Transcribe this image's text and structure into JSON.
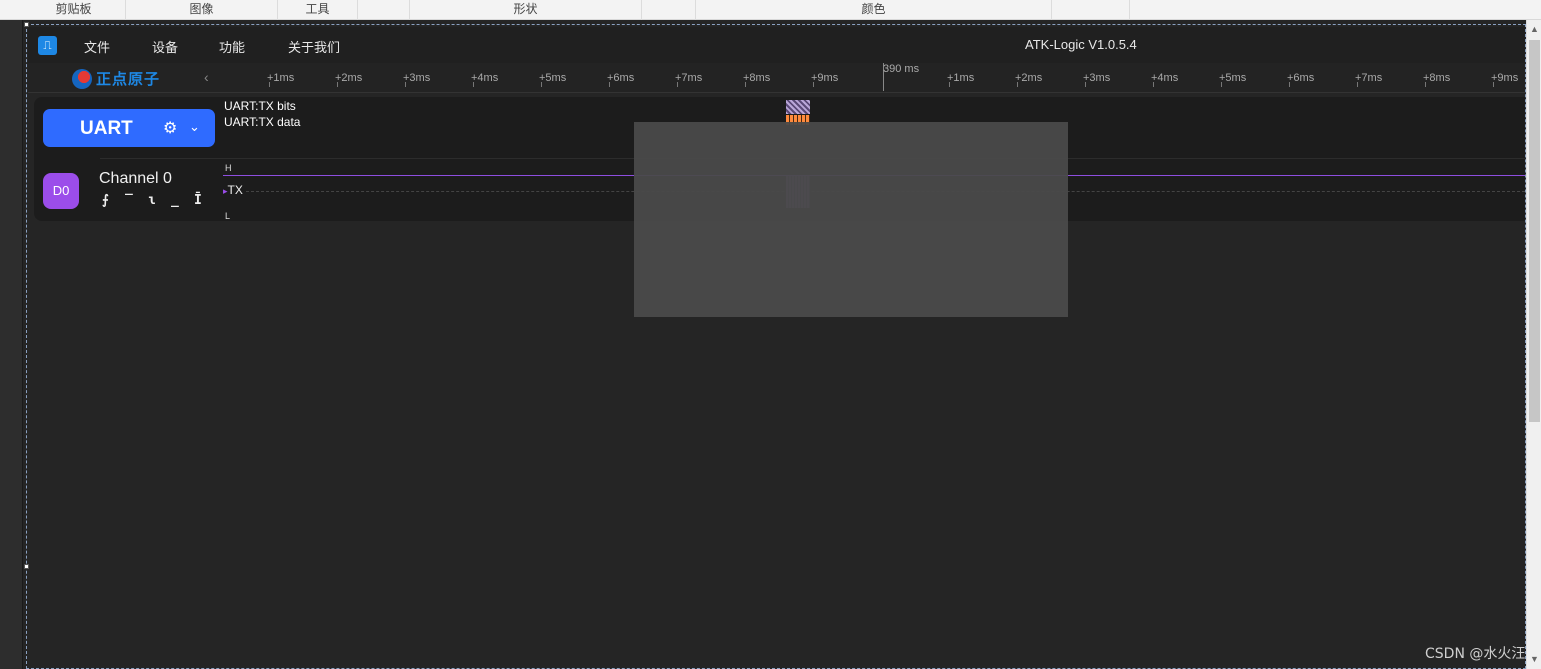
{
  "ribbon": {
    "groups": [
      "剪贴板",
      "图像",
      "工具",
      "形状",
      "颜色"
    ]
  },
  "app": {
    "logo_icon": "waveform-icon",
    "menu": [
      "文件",
      "设备",
      "功能",
      "关于我们"
    ],
    "title": "ATK-Logic  V1.0.5.4",
    "brand": "正点原子",
    "collapse_icon": "chevron-left-icon"
  },
  "timeline": {
    "marker_label": "390 ms",
    "ticks_left": [
      "+1ms",
      "+2ms",
      "+3ms",
      "+4ms",
      "+5ms",
      "+6ms",
      "+7ms",
      "+8ms",
      "+9ms"
    ],
    "ticks_right": [
      "+1ms",
      "+2ms",
      "+3ms",
      "+4ms",
      "+5ms",
      "+6ms",
      "+7ms",
      "+8ms",
      "+9ms"
    ]
  },
  "decoder": {
    "name": "UART",
    "settings_icon": "gear-icon",
    "dropdown_icon": "chevron-down-icon",
    "rows": [
      "UART:TX bits",
      "UART:TX data"
    ]
  },
  "channel": {
    "id": "D0",
    "name": "Channel 0",
    "signal": "TX",
    "high_label": "H",
    "low_label": "L",
    "trigger_icons": [
      "rising-edge-icon",
      "high-level-icon",
      "falling-edge-icon",
      "low-level-icon",
      "any-edge-icon"
    ],
    "trigger_glyphs": [
      "⨍",
      "‾",
      "ɩ",
      "_",
      "Ī"
    ]
  },
  "watermark": "CSDN @水火汪",
  "colors": {
    "accent": "#2f6bff",
    "channel": "#9b4dea",
    "data": "#ff8a3d"
  }
}
